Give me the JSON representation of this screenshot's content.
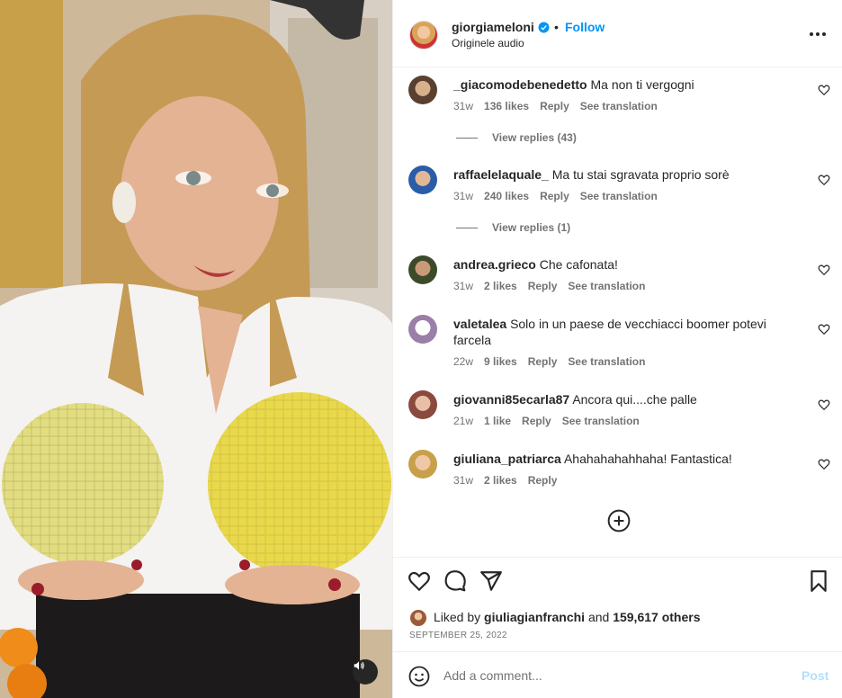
{
  "post": {
    "username": "giorgiameloni",
    "follow_label": "Follow",
    "separator": "•",
    "audio_label": "Originele audio"
  },
  "comments": [
    {
      "user": "_giacomodebenedetto",
      "text": "Ma non ti vergogni",
      "time": "31w",
      "likes": "136 likes",
      "reply": "Reply",
      "translate": "See translation",
      "replies_label": "View replies (43)"
    },
    {
      "user": "raffaelelaquale_",
      "text": "Ma tu stai sgravata proprio sorè",
      "time": "31w",
      "likes": "240 likes",
      "reply": "Reply",
      "translate": "See translation",
      "replies_label": "View replies (1)"
    },
    {
      "user": "andrea.grieco",
      "text": "Che cafonata!",
      "time": "31w",
      "likes": "2 likes",
      "reply": "Reply",
      "translate": "See translation"
    },
    {
      "user": "valetalea",
      "text": "Solo in un paese de vecchiacci boomer potevi farcela",
      "time": "22w",
      "likes": "9 likes",
      "reply": "Reply",
      "translate": "See translation"
    },
    {
      "user": "giovanni85ecarla87",
      "text": "Ancora qui....che palle",
      "time": "21w",
      "likes": "1 like",
      "reply": "Reply",
      "translate": "See translation"
    },
    {
      "user": "giuliana_patriarca",
      "text": "Ahahahahahhaha! Fantastica!",
      "time": "31w",
      "likes": "2 likes",
      "reply": "Reply"
    }
  ],
  "likes": {
    "prefix": "Liked by",
    "user": "giuliagianfranchi",
    "middle": "and",
    "count": "159,617 others"
  },
  "date": "SEPTEMBER 25, 2022",
  "composer": {
    "placeholder": "Add a comment...",
    "post_label": "Post"
  },
  "colors": {
    "accent": "#0095f6",
    "post_disabled": "#b2dffc",
    "secondary_text": "#737373"
  },
  "icons": [
    "verified-badge-icon",
    "more-options-icon",
    "heart-icon",
    "add-circle-icon",
    "comment-icon",
    "share-icon",
    "bookmark-icon",
    "emoji-icon",
    "speaker-icon"
  ]
}
